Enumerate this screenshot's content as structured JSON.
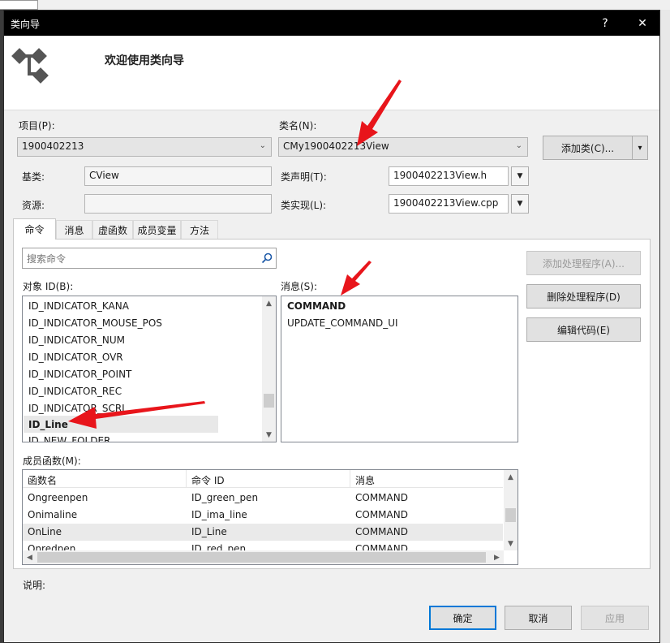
{
  "window": {
    "title": "类向导",
    "help_symbol": "?",
    "close_symbol": "✕"
  },
  "header": {
    "title": "欢迎使用类向导",
    "icon": "class-wizard-icon"
  },
  "project": {
    "label": "项目(P):",
    "value": "1900402213"
  },
  "classname": {
    "label": "类名(N):",
    "value": "CMy1900402213View"
  },
  "add_class_button": {
    "label": "添加类(C)...",
    "menu_symbol": "▾"
  },
  "base_class": {
    "label": "基类:",
    "value": "CView"
  },
  "class_decl": {
    "label": "类声明(T):",
    "value": "1900402213View.h"
  },
  "resource": {
    "label": "资源:",
    "value": ""
  },
  "class_impl": {
    "label": "类实现(L):",
    "value": "1900402213View.cpp"
  },
  "tabs": [
    {
      "label": "命令",
      "active": true
    },
    {
      "label": "消息",
      "active": false
    },
    {
      "label": "虚函数",
      "active": false
    },
    {
      "label": "成员变量",
      "active": false
    },
    {
      "label": "方法",
      "active": false
    }
  ],
  "search": {
    "placeholder": "搜索命令"
  },
  "object_ids": {
    "label": "对象 ID(B):",
    "items": [
      "ID_INDICATOR_KANA",
      "ID_INDICATOR_MOUSE_POS",
      "ID_INDICATOR_NUM",
      "ID_INDICATOR_OVR",
      "ID_INDICATOR_POINT",
      "ID_INDICATOR_REC",
      "ID_INDICATOR_SCRL",
      "ID_Line",
      "ID_NEW_FOLDER"
    ],
    "selected": "ID_Line"
  },
  "messages": {
    "label": "消息(S):",
    "items": [
      "COMMAND",
      "UPDATE_COMMAND_UI"
    ],
    "bold_item": "COMMAND"
  },
  "handler_buttons": {
    "add_handler": "添加处理程序(A)...",
    "delete_handler": "删除处理程序(D)",
    "edit_code": "编辑代码(E)"
  },
  "member_functions": {
    "label": "成员函数(M):",
    "columns": [
      "函数名",
      "命令 ID",
      "消息"
    ],
    "rows": [
      [
        "Ongreenpen",
        "ID_green_pen",
        "COMMAND"
      ],
      [
        "Onimaline",
        "ID_ima_line",
        "COMMAND"
      ],
      [
        "OnLine",
        "ID_Line",
        "COMMAND"
      ],
      [
        "Onredpen",
        "ID_red_pen",
        "COMMAND"
      ]
    ],
    "selected_row": 2
  },
  "description": {
    "label": "说明:"
  },
  "footer": {
    "ok": "确定",
    "cancel": "取消",
    "apply": "应用"
  },
  "colors": {
    "titlebar": "#000000",
    "annotation_arrow": "#e8151b",
    "selection": "#e8e8e8",
    "accent": "#0078d7"
  }
}
